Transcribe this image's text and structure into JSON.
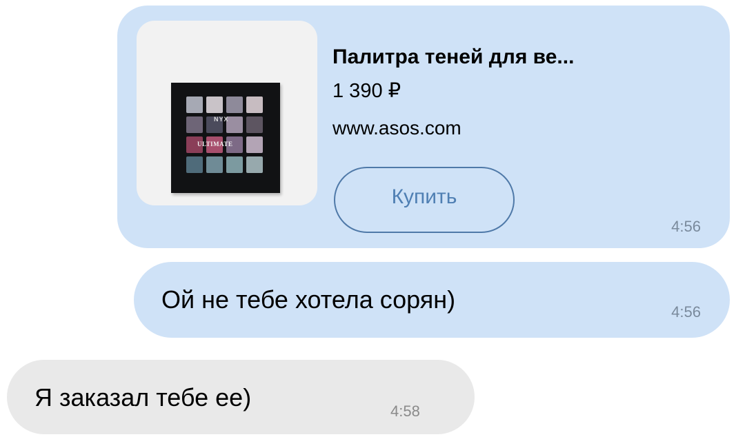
{
  "chat": {
    "product_card": {
      "title": "Палитра теней для ве...",
      "price": "1 390 ₽",
      "url": "www.asos.com",
      "buy_label": "Купить",
      "time": "4:56",
      "image": {
        "brand": "NYX",
        "name": "ULTIMATE",
        "swatches": [
          "#a6a9b4",
          "#c9c3c8",
          "#8e8a9a",
          "#c7bcc1",
          "#6e6577",
          "#4b4b5c",
          "#9a8ea1",
          "#5d5561",
          "#8a3e58",
          "#a74f6d",
          "#7d6a86",
          "#b3a4b5",
          "#4f6b7a",
          "#6f8b96",
          "#7c9aa0",
          "#97a9ad"
        ]
      }
    },
    "messages": [
      {
        "direction": "outgoing",
        "text": "Ой не тебе хотела сорян)",
        "time": "4:56"
      },
      {
        "direction": "incoming",
        "text": "Я заказал тебе ее)",
        "time": "4:58"
      }
    ]
  },
  "colors": {
    "outgoing_bubble": "#cfe2f7",
    "incoming_bubble": "#e9e9e9",
    "accent": "#4f7fb3",
    "timestamp": "#7a8a9c"
  }
}
